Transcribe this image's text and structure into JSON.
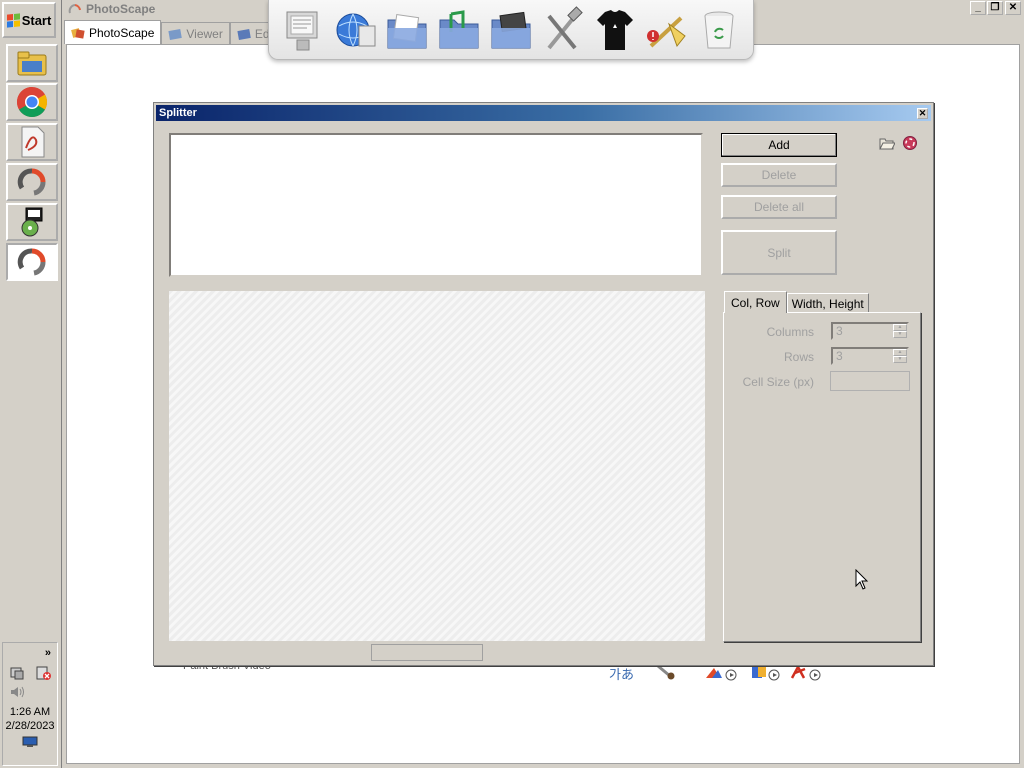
{
  "taskbar": {
    "start_label": "Start",
    "tray_expand": "»",
    "clock_time": "1:26 AM",
    "clock_date": "2/28/2023"
  },
  "photoscape": {
    "title": "PhotoScape",
    "tabs": [
      {
        "label": "PhotoScape"
      },
      {
        "label": "Viewer"
      },
      {
        "label": "Editor"
      }
    ],
    "bottom_label": "Paint Brush  Video",
    "bottom_icon_text": "가あ"
  },
  "splitter": {
    "title": "Splitter",
    "buttons": {
      "add": "Add",
      "delete": "Delete",
      "delete_all": "Delete all",
      "split": "Split"
    },
    "tabs": {
      "col_row": "Col, Row",
      "width_height": "Width, Height"
    },
    "options": {
      "columns_label": "Columns",
      "columns_value": "3",
      "rows_label": "Rows",
      "rows_value": "3",
      "cell_size_label": "Cell Size (px)",
      "cell_size_value": ""
    }
  },
  "colors": {
    "title_gradient_start": "#0a246a",
    "title_gradient_end": "#a6caf0",
    "window_face": "#d4d0c8"
  }
}
